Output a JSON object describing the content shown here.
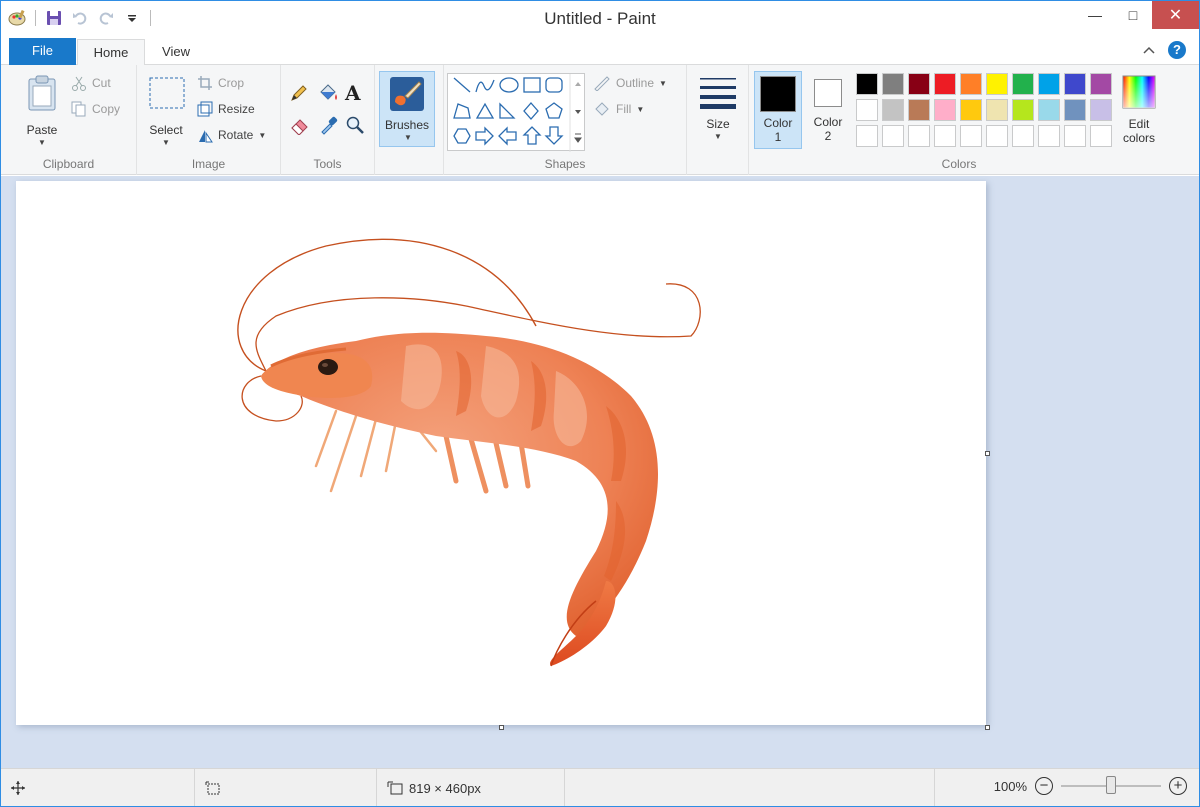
{
  "app": {
    "title": "Untitled - Paint"
  },
  "window_controls": {
    "minimize": "—",
    "maximize": "□",
    "close": "✕"
  },
  "tabs": {
    "file": "File",
    "home": "Home",
    "view": "View"
  },
  "ribbon": {
    "clipboard": {
      "paste": "Paste",
      "cut": "Cut",
      "copy": "Copy",
      "group": "Clipboard"
    },
    "image": {
      "select": "Select",
      "crop": "Crop",
      "resize": "Resize",
      "rotate": "Rotate",
      "group": "Image"
    },
    "tools": {
      "group": "Tools"
    },
    "brushes": {
      "label": "Brushes"
    },
    "shapes": {
      "outline": "Outline",
      "fill": "Fill",
      "group": "Shapes"
    },
    "size": {
      "label": "Size"
    },
    "colors": {
      "color1": "Color",
      "color1_num": "1",
      "color2": "Color",
      "color2_num": "2",
      "edit1": "Edit",
      "edit2": "colors",
      "group": "Colors",
      "color1_value": "#000000",
      "color2_value": "#ffffff",
      "palette_row1": [
        "#000000",
        "#7f7f7f",
        "#880015",
        "#ed1c24",
        "#ff7f27",
        "#fff200",
        "#22b14c",
        "#00a2e8",
        "#3f48cc",
        "#a349a4"
      ],
      "palette_row2": [
        "#ffffff",
        "#c3c3c3",
        "#b97a57",
        "#ffaec9",
        "#ffc90e",
        "#efe4b0",
        "#b5e61d",
        "#99d9ea",
        "#7092be",
        "#c8bfe7"
      ],
      "palette_row3": [
        "#ffffff",
        "#ffffff",
        "#ffffff",
        "#ffffff",
        "#ffffff",
        "#ffffff",
        "#ffffff",
        "#ffffff",
        "#ffffff",
        "#ffffff"
      ]
    }
  },
  "status": {
    "dimensions": "819 × 460px",
    "zoom": "100%",
    "zoom_fraction": 0.5
  }
}
